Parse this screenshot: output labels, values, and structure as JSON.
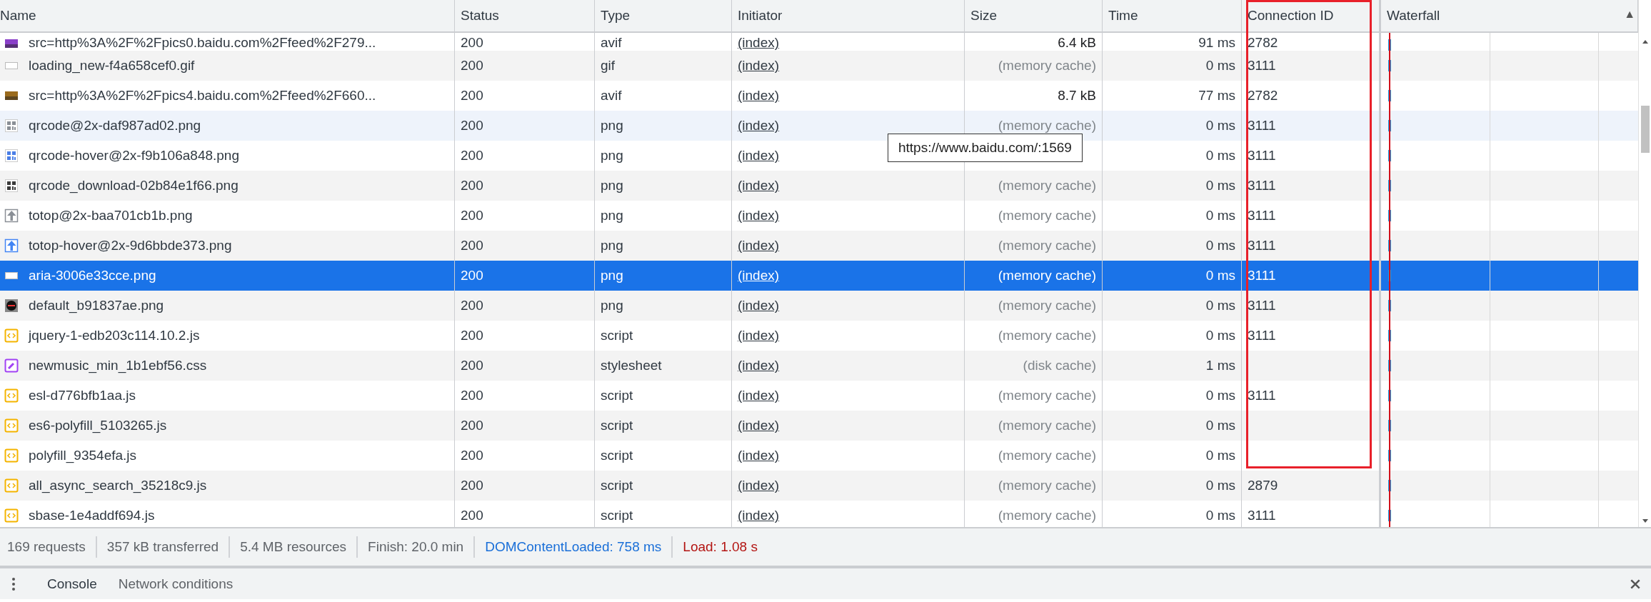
{
  "table": {
    "columns": [
      "Name",
      "Status",
      "Type",
      "Initiator",
      "Size",
      "Time",
      "Connection ID",
      "Waterfall"
    ],
    "sort_indicator": "▲",
    "rows": [
      {
        "name": "src=http%3A%2F%2Fpics0.baidu.com%2Ffeed%2F279...",
        "kind": "photo",
        "color": "#8a3fc9",
        "status": "200",
        "type": "avif",
        "initiator": "(index)",
        "size": "6.4 kB",
        "from_cache": false,
        "time": "91 ms",
        "connection": "2782",
        "selected": false,
        "hovered": false
      },
      {
        "name": "loading_new-f4a658cef0.gif",
        "kind": "blank",
        "status": "200",
        "type": "gif",
        "initiator": "(index)",
        "size": "(memory cache)",
        "from_cache": true,
        "time": "0 ms",
        "connection": "3111",
        "selected": false,
        "hovered": false
      },
      {
        "name": "src=http%3A%2F%2Fpics4.baidu.com%2Ffeed%2F660...",
        "kind": "photo",
        "color": "#9a6a1c",
        "status": "200",
        "type": "avif",
        "initiator": "(index)",
        "size": "8.7 kB",
        "from_cache": false,
        "time": "77 ms",
        "connection": "2782",
        "selected": false,
        "hovered": false
      },
      {
        "name": "qrcode@2x-daf987ad02.png",
        "kind": "qr",
        "color": "#8a8f96",
        "status": "200",
        "type": "png",
        "initiator": "(index)",
        "size": "(memory cache)",
        "from_cache": true,
        "time": "0 ms",
        "connection": "3111",
        "selected": false,
        "hovered": true
      },
      {
        "name": "qrcode-hover@2x-f9b106a848.png",
        "kind": "qr",
        "color": "#4a7ee6",
        "status": "200",
        "type": "png",
        "initiator": "(index)",
        "time": "0 ms",
        "connection": "3111",
        "selected": false,
        "hovered": false
      },
      {
        "name": "qrcode_download-02b84e1f66.png",
        "kind": "qr",
        "color": "#3a3a3a",
        "status": "200",
        "type": "png",
        "initiator": "(index)",
        "size": "(memory cache)",
        "from_cache": true,
        "time": "0 ms",
        "connection": "3111",
        "selected": false,
        "hovered": false
      },
      {
        "name": "totop@2x-baa701cb1b.png",
        "kind": "arrow",
        "color": "#8a8f96",
        "status": "200",
        "type": "png",
        "initiator": "(index)",
        "size": "(memory cache)",
        "from_cache": true,
        "time": "0 ms",
        "connection": "3111",
        "selected": false,
        "hovered": false
      },
      {
        "name": "totop-hover@2x-9d6bbde373.png",
        "kind": "arrow",
        "color": "#4285f4",
        "status": "200",
        "type": "png",
        "initiator": "(index)",
        "size": "(memory cache)",
        "from_cache": true,
        "time": "0 ms",
        "connection": "3111",
        "selected": false,
        "hovered": false
      },
      {
        "name": "aria-3006e33cce.png",
        "kind": "blank",
        "status": "200",
        "type": "png",
        "initiator": "(index)",
        "size": "(memory cache)",
        "from_cache": true,
        "time": "0 ms",
        "connection": "3111",
        "selected": true,
        "hovered": false
      },
      {
        "name": "default_b91837ae.png",
        "kind": "disc",
        "status": "200",
        "type": "png",
        "initiator": "(index)",
        "size": "(memory cache)",
        "from_cache": true,
        "time": "0 ms",
        "connection": "3111",
        "selected": false,
        "hovered": false
      },
      {
        "name": "jquery-1-edb203c114.10.2.js",
        "kind": "script",
        "status": "200",
        "type": "script",
        "initiator": "(index)",
        "size": "(memory cache)",
        "from_cache": true,
        "time": "0 ms",
        "connection": "3111",
        "selected": false,
        "hovered": false
      },
      {
        "name": "newmusic_min_1b1ebf56.css",
        "kind": "style",
        "status": "200",
        "type": "stylesheet",
        "initiator": "(index)",
        "size": "(disk cache)",
        "from_cache": true,
        "time": "1 ms",
        "selected": false,
        "hovered": false
      },
      {
        "name": "esl-d776bfb1aa.js",
        "kind": "script",
        "status": "200",
        "type": "script",
        "initiator": "(index)",
        "size": "(memory cache)",
        "from_cache": true,
        "time": "0 ms",
        "connection": "3111",
        "selected": false,
        "hovered": false
      },
      {
        "name": "es6-polyfill_5103265.js",
        "kind": "script",
        "status": "200",
        "type": "script",
        "initiator": "(index)",
        "size": "(memory cache)",
        "from_cache": true,
        "time": "0 ms",
        "selected": false,
        "hovered": false
      },
      {
        "name": "polyfill_9354efa.js",
        "kind": "script",
        "status": "200",
        "type": "script",
        "initiator": "(index)",
        "size": "(memory cache)",
        "from_cache": true,
        "time": "0 ms",
        "selected": false,
        "hovered": false
      },
      {
        "name": "all_async_search_35218c9.js",
        "kind": "script",
        "status": "200",
        "type": "script",
        "initiator": "(index)",
        "size": "(memory cache)",
        "from_cache": true,
        "time": "0 ms",
        "connection": "2879",
        "selected": false,
        "hovered": false
      },
      {
        "name": "sbase-1e4addf694.js",
        "kind": "script",
        "status": "200",
        "type": "script",
        "initiator": "(index)",
        "size": "(memory cache)",
        "from_cache": true,
        "time": "0 ms",
        "connection": "3111",
        "selected": false,
        "hovered": false
      }
    ]
  },
  "tooltip": "https://www.baidu.com/:1569",
  "status_bar": [
    {
      "text": "169 requests",
      "kind": "plain"
    },
    {
      "text": "357 kB transferred",
      "kind": "plain"
    },
    {
      "text": "5.4 MB resources",
      "kind": "plain"
    },
    {
      "text": "Finish: 20.0 min",
      "kind": "plain"
    },
    {
      "text": "DOMContentLoaded: 758 ms",
      "kind": "dom"
    },
    {
      "text": "Load: 1.08 s",
      "kind": "load"
    }
  ],
  "drawer_tabs": [
    {
      "label": "Console",
      "selected": true
    },
    {
      "label": "Network conditions",
      "selected": false
    }
  ]
}
